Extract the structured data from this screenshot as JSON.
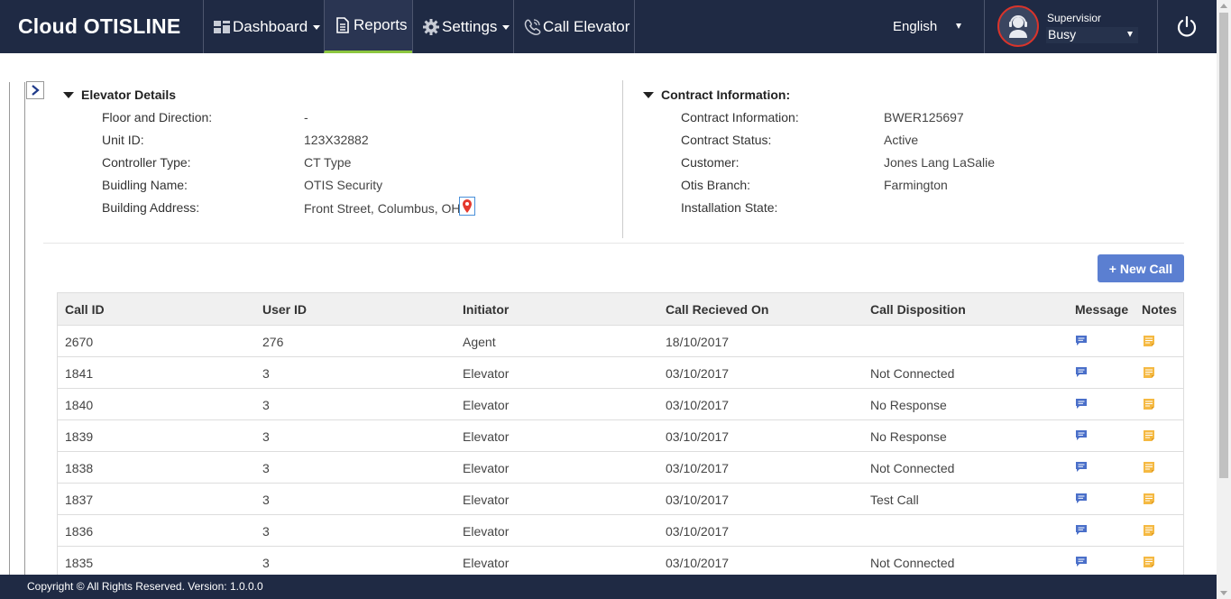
{
  "brand": "Cloud OTISLINE",
  "nav": {
    "dashboard": "Dashboard",
    "reports": "Reports",
    "settings": "Settings",
    "call_elevator": "Call Elevator"
  },
  "language": "English",
  "user": {
    "role": "Supervisior",
    "status": "Busy"
  },
  "elevator_details": {
    "title": "Elevator Details",
    "fields": [
      {
        "label": "Floor and Direction:",
        "value": "-"
      },
      {
        "label": "Unit ID:",
        "value": "123X32882"
      },
      {
        "label": "Controller Type:",
        "value": "CT Type"
      },
      {
        "label": "Buidling Name:",
        "value": "OTIS Security"
      },
      {
        "label": "Building Address:",
        "value": "Front Street, Columbus, OH"
      }
    ]
  },
  "contract_information": {
    "title": "Contract Information:",
    "fields": [
      {
        "label": "Contract Information:",
        "value": "BWER125697"
      },
      {
        "label": "Contract Status:",
        "value": "Active"
      },
      {
        "label": "Customer:",
        "value": "Jones Lang LaSalie"
      },
      {
        "label": "Otis Branch:",
        "value": "Farmington"
      },
      {
        "label": "Installation State:",
        "value": ""
      }
    ]
  },
  "new_call_label": "+ New Call",
  "table": {
    "headers": {
      "call_id": "Call ID",
      "user_id": "User ID",
      "initiator": "Initiator",
      "received": "Call Recieved On",
      "disposition": "Call Disposition",
      "message": "Message",
      "notes": "Notes"
    },
    "rows": [
      {
        "call_id": "2670",
        "user_id": "276",
        "initiator": "Agent",
        "received": "18/10/2017",
        "disposition": ""
      },
      {
        "call_id": "1841",
        "user_id": "3",
        "initiator": "Elevator",
        "received": "03/10/2017",
        "disposition": "Not Connected"
      },
      {
        "call_id": "1840",
        "user_id": "3",
        "initiator": "Elevator",
        "received": "03/10/2017",
        "disposition": "No Response"
      },
      {
        "call_id": "1839",
        "user_id": "3",
        "initiator": "Elevator",
        "received": "03/10/2017",
        "disposition": "No Response"
      },
      {
        "call_id": "1838",
        "user_id": "3",
        "initiator": "Elevator",
        "received": "03/10/2017",
        "disposition": "Not Connected"
      },
      {
        "call_id": "1837",
        "user_id": "3",
        "initiator": "Elevator",
        "received": "03/10/2017",
        "disposition": "Test Call"
      },
      {
        "call_id": "1836",
        "user_id": "3",
        "initiator": "Elevator",
        "received": "03/10/2017",
        "disposition": ""
      },
      {
        "call_id": "1835",
        "user_id": "3",
        "initiator": "Elevator",
        "received": "03/10/2017",
        "disposition": "Not Connected"
      }
    ]
  },
  "footer": "Copyright © All Rights Reserved. Version: 1.0.0.0",
  "colors": {
    "header_bg": "#1f2a44",
    "active_underline": "#8cc63f",
    "button_blue": "#5b7fd1",
    "message_icon": "#4a6fc9",
    "notes_icon": "#f5b942",
    "avatar_ring": "#d9342b"
  },
  "icons": {
    "dashboard": "dashboard-grid-icon",
    "reports": "document-icon",
    "settings": "gear-icon",
    "call_elevator": "phone-icon",
    "message": "chat-bubble-icon",
    "notes": "note-icon",
    "power": "power-icon",
    "map": "map-pin-icon"
  }
}
